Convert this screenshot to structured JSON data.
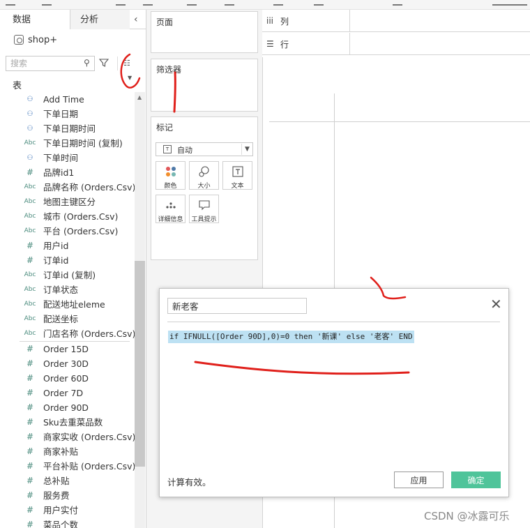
{
  "data_pane": {
    "tabs": [
      {
        "label": "数据"
      },
      {
        "label": "分析"
      }
    ],
    "data_source": "shop+",
    "search": {
      "placeholder": "搜索"
    },
    "section_label": "表",
    "fields_top": [
      {
        "icon": "date",
        "label": "Add Time"
      },
      {
        "icon": "date",
        "label": "下单日期"
      },
      {
        "icon": "date",
        "label": "下单日期时间"
      },
      {
        "icon": "abc",
        "label": "下单日期时间 (复制)"
      },
      {
        "icon": "date",
        "label": "下单时间"
      },
      {
        "icon": "hash",
        "label": "品牌id1"
      },
      {
        "icon": "abc",
        "label": "品牌名称 (Orders.Csv)"
      },
      {
        "icon": "abc",
        "label": "地图主键区分"
      },
      {
        "icon": "abc",
        "label": "城市 (Orders.Csv)"
      },
      {
        "icon": "abc",
        "label": "平台 (Orders.Csv)"
      },
      {
        "icon": "hash",
        "label": "用户id"
      },
      {
        "icon": "hash",
        "label": "订单id"
      },
      {
        "icon": "abc",
        "label": "订单id (复制)"
      },
      {
        "icon": "abc",
        "label": "订单状态"
      },
      {
        "icon": "abc",
        "label": "配送地址eleme"
      },
      {
        "icon": "abc",
        "label": "配送坐标"
      },
      {
        "icon": "abc",
        "label": "门店名称 (Orders.Csv)"
      }
    ],
    "fields_measures": [
      {
        "icon": "hash",
        "label": "Order 15D"
      },
      {
        "icon": "hash",
        "label": "Order 30D"
      },
      {
        "icon": "hash",
        "label": "Order 60D"
      },
      {
        "icon": "hash",
        "label": "Order 7D"
      },
      {
        "icon": "hash",
        "label": "Order 90D"
      },
      {
        "icon": "hash",
        "label": "Sku去重菜品数"
      },
      {
        "icon": "hash",
        "label": "商家实收 (Orders.Csv)"
      },
      {
        "icon": "hash",
        "label": "商家补贴"
      },
      {
        "icon": "hash",
        "label": "平台补贴 (Orders.Csv)"
      },
      {
        "icon": "hash",
        "label": "总补贴"
      },
      {
        "icon": "hash",
        "label": "服务费"
      },
      {
        "icon": "hash",
        "label": "用户实付"
      },
      {
        "icon": "hash",
        "label": "菜品个数"
      }
    ]
  },
  "cards": {
    "pages": "页面",
    "filters": "筛选器",
    "marks": {
      "title": "标记",
      "type": "自动",
      "buttons": [
        {
          "label": "颜色"
        },
        {
          "label": "大小"
        },
        {
          "label": "文本"
        },
        {
          "label": "详细信息"
        },
        {
          "label": "工具提示"
        }
      ]
    }
  },
  "shelves": {
    "columns": "列",
    "rows": "行"
  },
  "calc_dialog": {
    "name": "新老客",
    "formula": "if IFNULL([Order 90D],0)=0 then '新课' else '老客' END",
    "status": "计算有效。",
    "apply_label": "应用",
    "ok_label": "确定"
  },
  "watermark": "CSDN @冰露可乐",
  "colors": {
    "confirm_green": "#4fc49a",
    "formula_highlight": "#bde1f3",
    "annotation_red": "#e0201b"
  }
}
